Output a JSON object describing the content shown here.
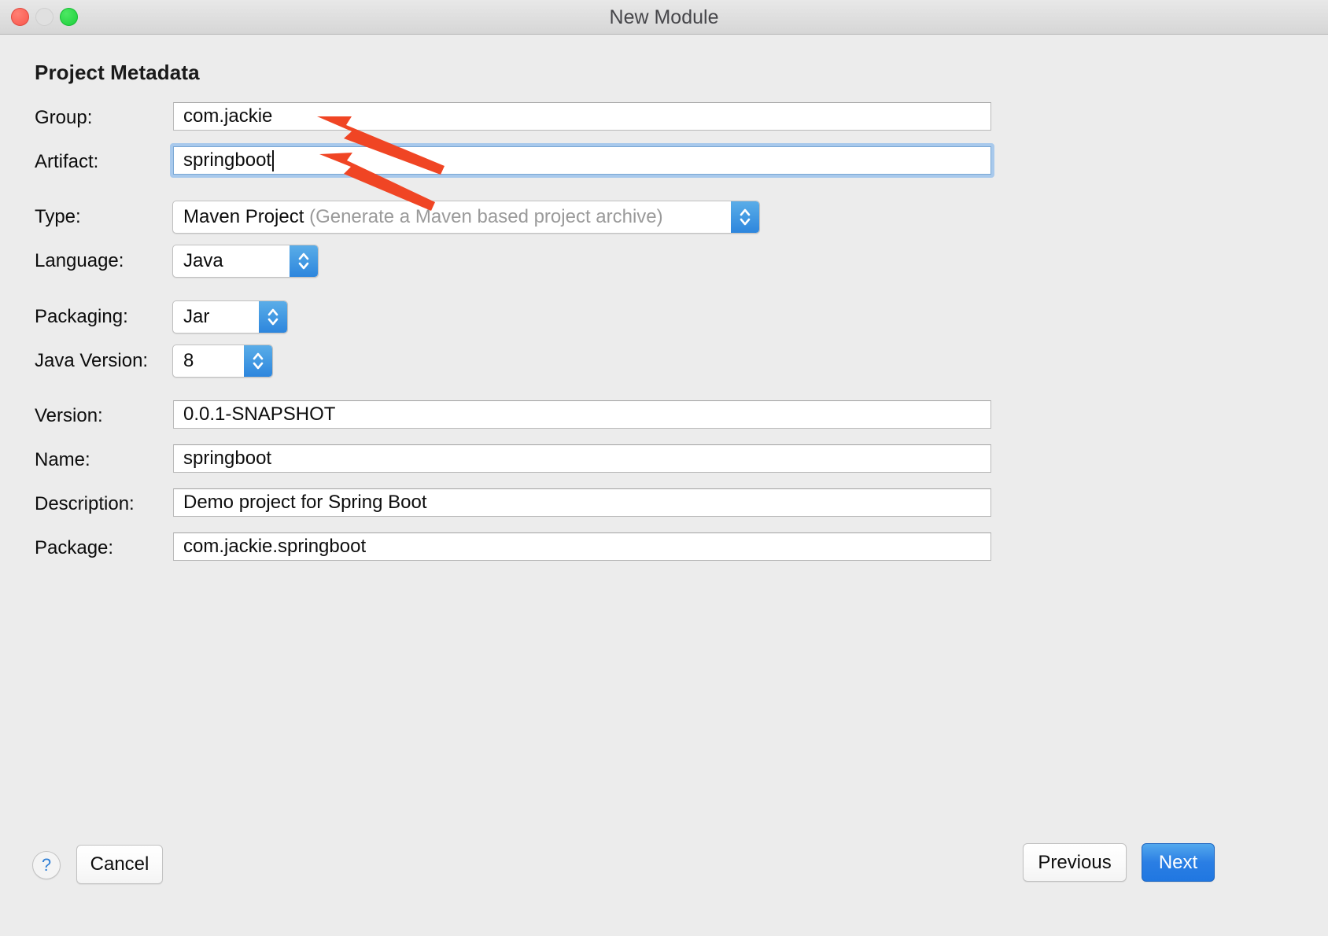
{
  "window": {
    "title": "New Module",
    "traffic_lights": [
      "close-red",
      "minimize-yellow",
      "zoom-green"
    ]
  },
  "section": {
    "title": "Project Metadata"
  },
  "fields": {
    "group": {
      "label": "Group:",
      "value": "com.jackie"
    },
    "artifact": {
      "label": "Artifact:",
      "value": "springboot",
      "focused": true
    },
    "type": {
      "label": "Type:",
      "value": "Maven Project",
      "hint": "(Generate a Maven based project archive)"
    },
    "language": {
      "label": "Language:",
      "value": "Java"
    },
    "packaging": {
      "label": "Packaging:",
      "value": "Jar"
    },
    "javaversion": {
      "label": "Java Version:",
      "value": "8"
    },
    "version": {
      "label": "Version:",
      "value": "0.0.1-SNAPSHOT"
    },
    "name": {
      "label": "Name:",
      "value": "springboot"
    },
    "description": {
      "label": "Description:",
      "value": "Demo project for Spring Boot"
    },
    "package": {
      "label": "Package:",
      "value": "com.jackie.springboot"
    }
  },
  "footer": {
    "help_label": "?",
    "cancel_label": "Cancel",
    "previous_label": "Previous",
    "next_label": "Next"
  },
  "colors": {
    "accent_blue": "#2a7ee4",
    "stepper_blue": "#2d86dd",
    "focus_ring": "#a8c9ec",
    "annotation_red": "#f04524",
    "window_bg": "#ececec"
  }
}
